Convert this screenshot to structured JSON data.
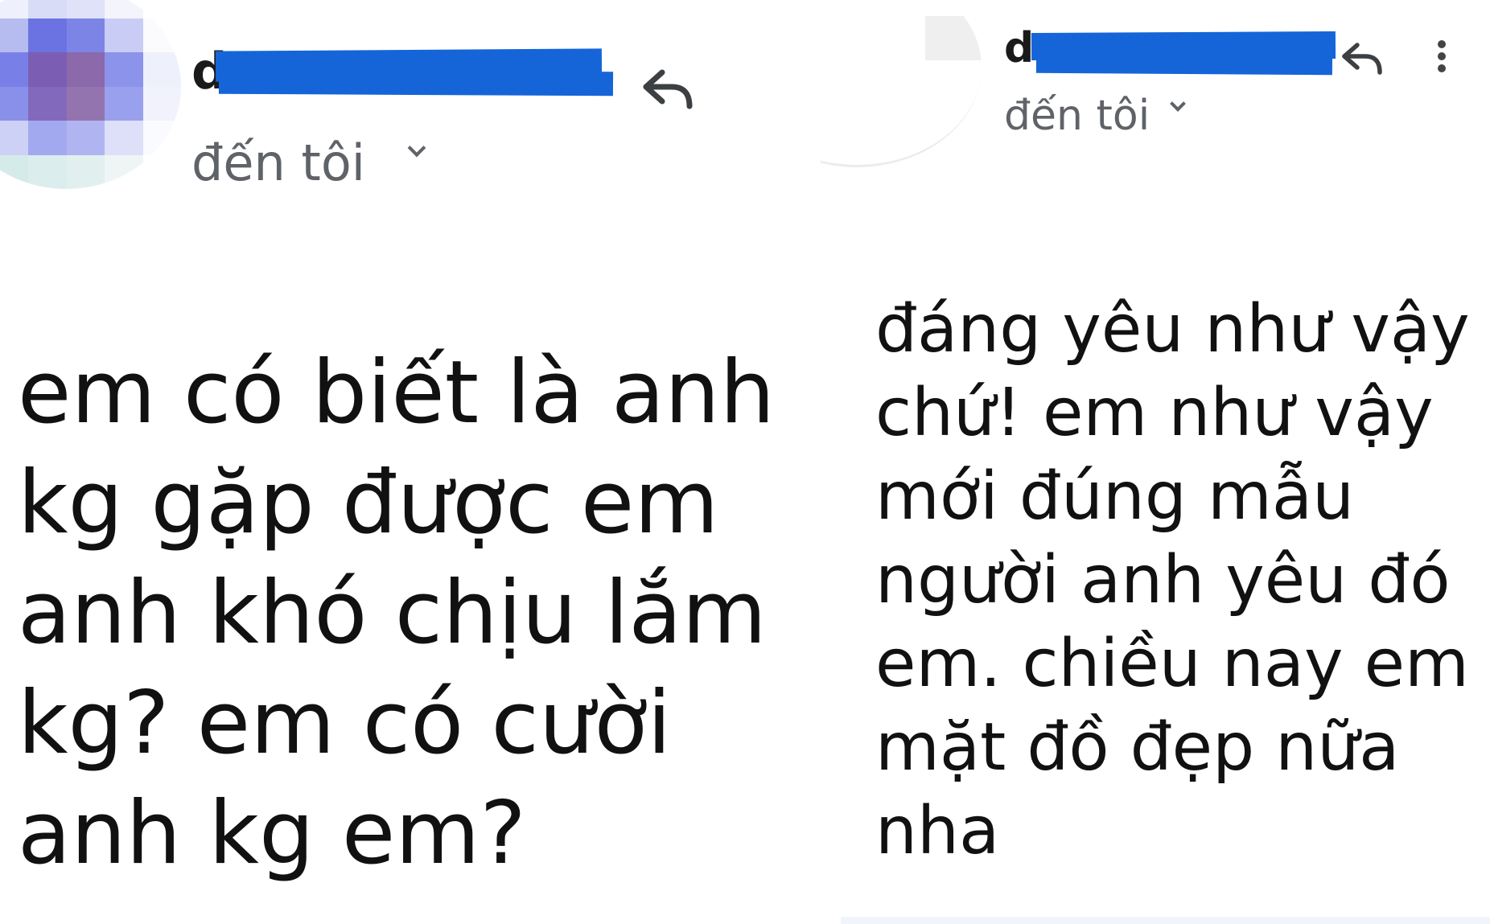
{
  "left_email": {
    "sender_visible": "d",
    "recipient_line": "đến tôi",
    "body_lines": [
      "em có biết là anh",
      "kg gặp được em",
      "anh khó chịu lắm",
      "kg? em có cười",
      "anh kg em?"
    ]
  },
  "right_email": {
    "sender_visible": "d",
    "recipient_line": "đến tôi",
    "body_lines": [
      "đáng yêu như vậy",
      "chứ! em như vậy",
      "mới đúng mẫu",
      "người anh yêu đó",
      "em.  chiều nay em",
      "mặt đồ đẹp nữa",
      "nha"
    ]
  },
  "icons": {
    "reply": "reply-arrow-icon",
    "more": "more-vert-icon",
    "expand": "chevron-down-icon"
  },
  "colors": {
    "redaction": "#1565d8",
    "secondary_text": "#5f6368",
    "body_text": "#111111"
  }
}
